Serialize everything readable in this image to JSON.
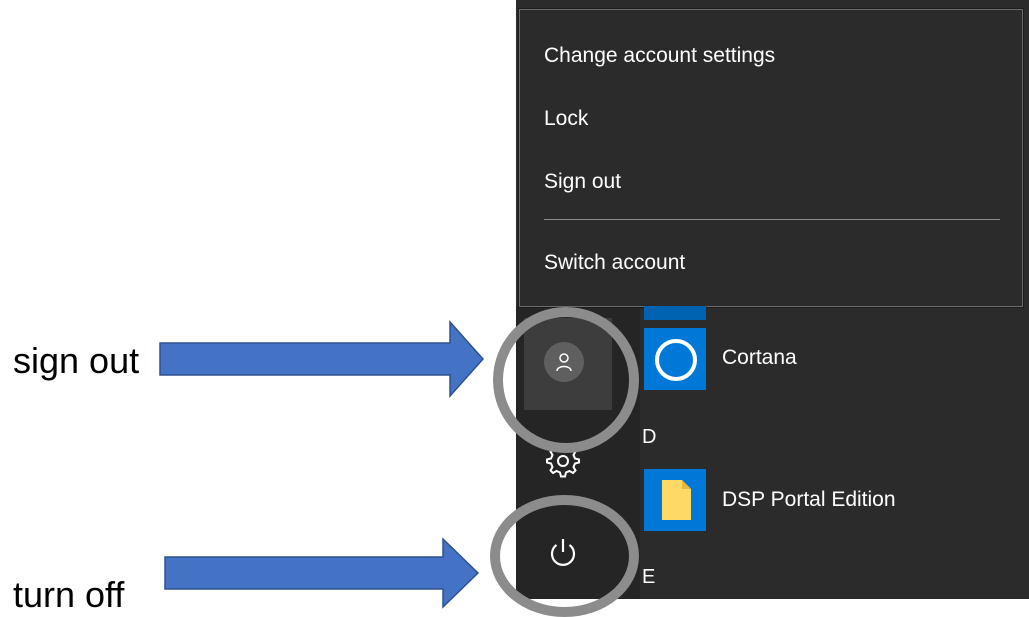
{
  "account_menu": {
    "items": [
      {
        "label": "Change account settings"
      },
      {
        "label": "Lock"
      },
      {
        "label": "Sign out"
      },
      {
        "label": "Switch account"
      }
    ]
  },
  "rail": {
    "user_icon": "user-icon",
    "settings_icon": "gear-icon",
    "power_icon": "power-icon"
  },
  "app_list": {
    "apps": [
      {
        "label": "Cortana",
        "icon": "cortana-icon"
      },
      {
        "label": "DSP Portal Edition",
        "icon": "folder-icon"
      }
    ],
    "letters": [
      "D",
      "E"
    ]
  },
  "annotations": {
    "sign_out_label": "sign out",
    "turn_off_label": "turn off",
    "arrow_color": "#4472c4",
    "ring_color": "#8c8c8c"
  },
  "colors": {
    "start_background": "#2b2b2b",
    "tile_blue": "#0078d7",
    "folder_yellow": "#ffd966"
  }
}
